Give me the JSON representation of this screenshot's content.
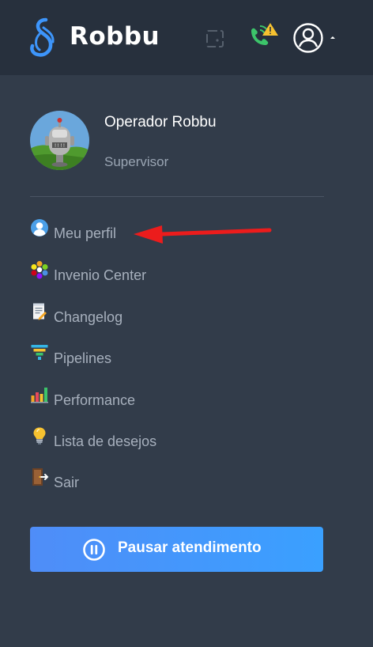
{
  "header": {
    "brand": "Robbu"
  },
  "profile": {
    "name": "Operador Robbu",
    "role": "Supervisor"
  },
  "menu": [
    {
      "label": "Meu perfil",
      "icon": "user-icon"
    },
    {
      "label": "Invenio Center",
      "icon": "grid-icon"
    },
    {
      "label": "Changelog",
      "icon": "document-icon"
    },
    {
      "label": "Pipelines",
      "icon": "funnel-icon"
    },
    {
      "label": "Performance",
      "icon": "bar-chart-icon"
    },
    {
      "label": "Lista de desejos",
      "icon": "lightbulb-icon"
    },
    {
      "label": "Sair",
      "icon": "exit-door-icon"
    }
  ],
  "pause_button": {
    "label": "Pausar atendimento"
  },
  "colors": {
    "header_bg": "#27303d",
    "panel_bg": "#323c4a",
    "accent_blue": "#3d95fb",
    "phone_green": "#3cc46a",
    "warning_yellow": "#f7c230",
    "arrow_red": "#ec1c1c"
  }
}
